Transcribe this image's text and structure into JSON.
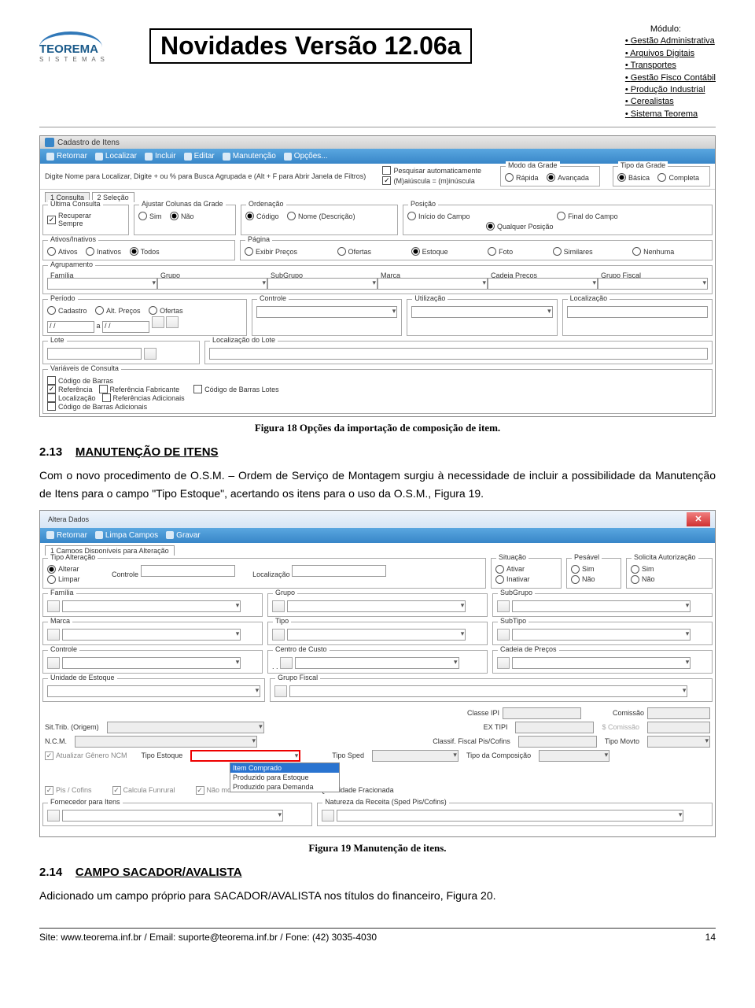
{
  "header": {
    "logo_name": "TEOREMA",
    "logo_sub": "S I S T E M A S",
    "title": "Novidades Versão 12.06a",
    "module_label": "Módulo:",
    "modules": [
      "Gestão Administrativa",
      "Arquivos Digitais",
      "Transportes",
      "Gestão Fisco Contábil",
      "Produção Industrial",
      "Cerealistas",
      "Sistema Teorema"
    ]
  },
  "shot1": {
    "window_title": "Cadastro de Itens",
    "toolbar": {
      "retornar": "Retornar",
      "localizar": "Localizar",
      "incluir": "Incluir",
      "editar": "Editar",
      "manutencao": "Manutenção",
      "opcoes": "Opções..."
    },
    "hint": "Digite Nome para Localizar, Digite + ou % para Busca Agrupada e (Alt + F para Abrir Janela de Filtros)",
    "pesq_auto": "Pesquisar automaticamente",
    "maimin": "(M)aiúscula = (m)inúscula",
    "modo_grade": "Modo da Grade",
    "mg_rap": "Rápida",
    "mg_ava": "Avançada",
    "tipo_grade": "Tipo da Grade",
    "tg_bas": "Básica",
    "tg_com": "Completa",
    "tab1": "1 Consulta",
    "tab2": "2 Seleção",
    "ultima": "Última Consulta",
    "recuperar": "Recuperar Sempre",
    "ajustar": "Ajustar Colunas da Grade",
    "sim": "Sim",
    "nao": "Não",
    "ordenacao": "Ordenação",
    "codigo": "Código",
    "nomedesc": "Nome (Descrição)",
    "posicao": "Posição",
    "inicio": "Início do Campo",
    "final": "Final do Campo",
    "qualquer": "Qualquer Posição",
    "ativos": "Ativos/Inativos",
    "at": "Ativos",
    "ina": "Inativos",
    "todos": "Todos",
    "pagina": "Página",
    "exibir": "Exibir Preços",
    "ofertas": "Ofertas",
    "estoque": "Estoque",
    "foto": "Foto",
    "similares": "Similares",
    "nenhuma": "Nenhuma",
    "agrupamento": "Agrupamento",
    "familia": "Família",
    "grupo": "Grupo",
    "subgrupo": "SubGrupo",
    "marca": "Marca",
    "cadeia": "Cadeia Preços",
    "grupofiscal": "Grupo Fiscal",
    "periodo": "Período",
    "pcad": "Cadastro",
    "palt": "Alt. Preços",
    "pof": "Ofertas",
    "controle": "Controle",
    "utilizacao": "Utilização",
    "localizacao": "Localização",
    "lote": "Lote",
    "loclote": "Localização do Lote",
    "varconsulta": "Variáveis de Consulta",
    "codbarras": "Código de Barras",
    "referencia": "Referência",
    "reffab": "Referência Fabricante",
    "codbarralote": "Código de Barras Lotes",
    "localizacao2": "Localização",
    "refadd": "Referências Adicionais",
    "codbarraadd": "Código de Barras Adicionais",
    "date": "/  /",
    "a": "a"
  },
  "caption1": "Figura 18 Opções da importação de composição de item.",
  "sec213_num": "2.13",
  "sec213_title": "MANUTENÇÃO DE ITENS",
  "sec213_body": "Com o novo procedimento de O.S.M. – Ordem de Serviço de Montagem surgiu à necessidade de incluir a possibilidade da Manutenção de Itens para o campo \"Tipo Estoque\", acertando os itens para o uso da O.S.M., Figura 19.",
  "shot2": {
    "window_title": "Altera Dados",
    "toolbar": {
      "retornar": "Retornar",
      "limpa": "Limpa Campos",
      "gravar": "Gravar"
    },
    "tab1": "1 Campos Disponíveis para Alteração",
    "tipoalt": "Tipo Alteração",
    "alterar": "Alterar",
    "limpar": "Limpar",
    "controle": "Controle",
    "localizacao": "Localização",
    "situacao": "Situação",
    "ativar": "Ativar",
    "inativar": "Inativar",
    "pesavel": "Pesável",
    "sim": "Sim",
    "nao": "Não",
    "solicita": "Solicita Autorização",
    "familia": "Família",
    "grupo": "Grupo",
    "subgrupo": "SubGrupo",
    "marca": "Marca",
    "tipo": "Tipo",
    "subtipo": "SubTipo",
    "centro": "Centro de Custo",
    "cadeia": "Cadeia de Preços",
    "unidade": "Unidade de Estoque",
    "grupofiscal": "Grupo Fiscal",
    "classeipi": "Classe IPI",
    "comissao": "Comissão",
    "sittrib": "Sit.Trib. (Origem)",
    "extipi": "EX TIPI",
    "scomissao": "$ Comissão",
    "ncm": "N.C.M.",
    "classif": "Classif. Fiscal Pis/Cofins",
    "tipomovto": "Tipo Movto",
    "atualizar": "Atualizar Gênero NCM",
    "tipoestoque": "Tipo Estoque",
    "tiposped": "Tipo Sped",
    "tipocomp": "Tipo da Composição",
    "pis": "Pis / Cofins",
    "calcula": "Calcula Funrural",
    "naomov": "Não movi",
    "quant": "Quantidade Fracionada",
    "fornecedor": "Fornecedor para Itens",
    "natureza": "Natureza da Receita (Sped Pis/Cofins)",
    "dd1": "Item Comprado",
    "dd2": "Produzido para Estoque",
    "dd3": "Produzido para Demanda",
    "ccdots": ". ."
  },
  "caption2": "Figura 19 Manutenção de itens.",
  "sec214_num": "2.14",
  "sec214_title": "CAMPO SACADOR/AVALISTA",
  "sec214_body": "Adicionado um campo próprio para SACADOR/AVALISTA nos títulos do financeiro, Figura 20.",
  "footer": {
    "left": "Site: www.teorema.inf.br / Email: suporte@teorema.inf.br / Fone: (42) 3035-4030",
    "right": "14"
  }
}
